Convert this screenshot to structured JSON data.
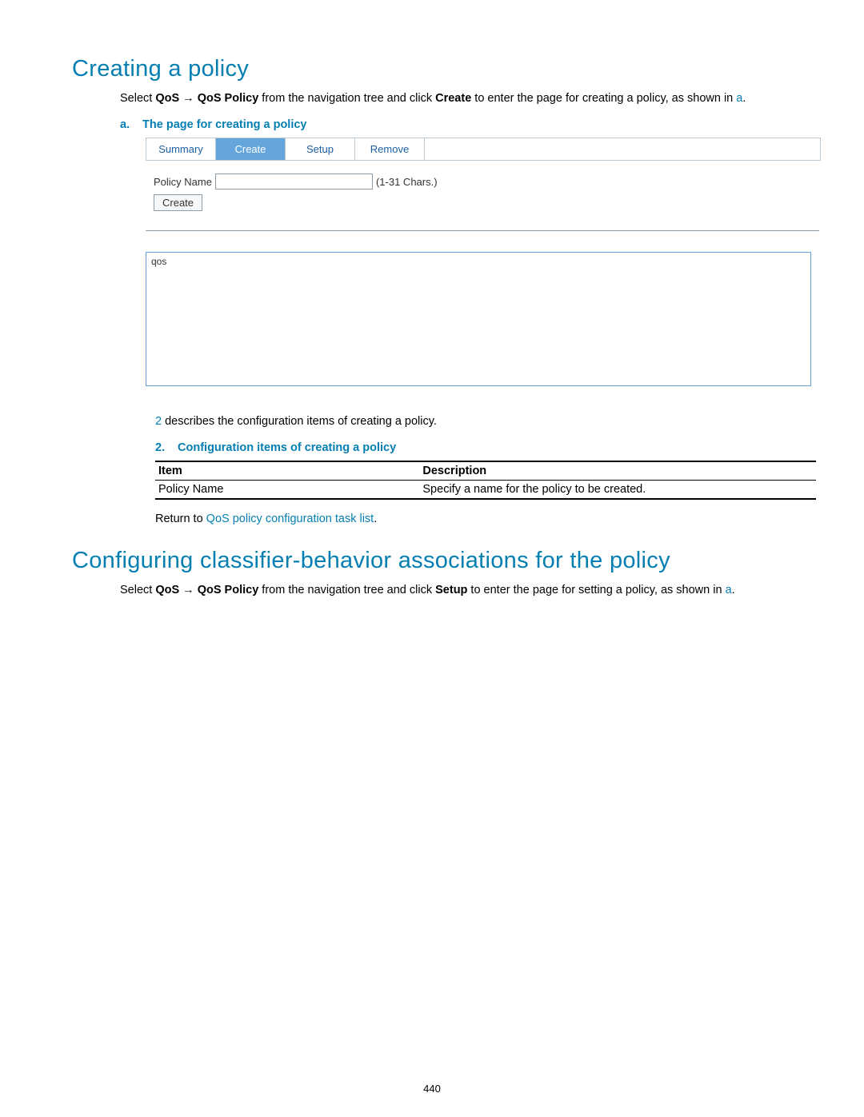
{
  "section1": {
    "title": "Creating a policy",
    "intro_parts": {
      "p1": "Select ",
      "b1": "QoS",
      "arrow": " → ",
      "b2": "QoS Policy",
      "p2": " from the navigation tree and click ",
      "b3": "Create",
      "p3": " to enter the page for creating a policy, as shown in ",
      "ref": "a",
      "p4": "."
    },
    "figure_label": "a.",
    "figure_title": "The page for creating a policy",
    "tabs": {
      "summary": "Summary",
      "create": "Create",
      "setup": "Setup",
      "remove": "Remove"
    },
    "form": {
      "label": "Policy Name",
      "hint": "(1-31 Chars.)",
      "button": "Create",
      "listbox_value": "qos"
    },
    "desc_line": {
      "ref": "2",
      "text": " describes the configuration items of creating a policy."
    },
    "table_caption_label": "2.",
    "table_caption_title": "Configuration items of creating a policy",
    "table": {
      "header_item": "Item",
      "header_desc": "Description",
      "row_item": "Policy Name",
      "row_desc": "Specify a name for the policy to be created."
    },
    "return": {
      "prefix": "Return to ",
      "link": "QoS policy configuration task list",
      "suffix": "."
    }
  },
  "section2": {
    "title": "Configuring classifier-behavior associations for the policy",
    "intro_parts": {
      "p1": "Select ",
      "b1": "QoS",
      "arrow": " → ",
      "b2": "QoS Policy",
      "p2": " from the navigation tree and click ",
      "b3": "Setup",
      "p3": " to enter the page for setting a policy, as shown in ",
      "ref": "a",
      "p4": "."
    }
  },
  "page_number": "440"
}
